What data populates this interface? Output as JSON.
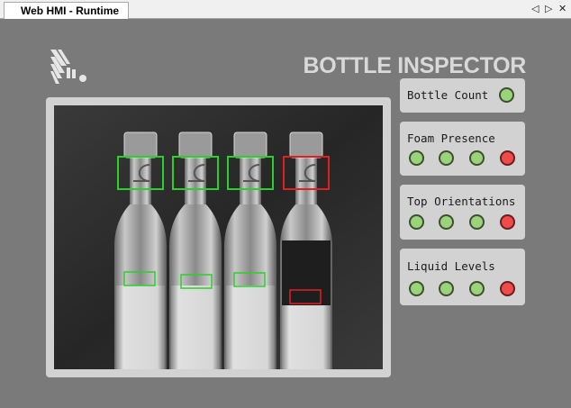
{
  "tab": {
    "title": "Web HMI - Runtime"
  },
  "tab_controls": {
    "prev": "◁",
    "next": "▷",
    "close": "✕"
  },
  "header": {
    "title": "BOTTLE INSPECTOR"
  },
  "panels": {
    "bottle_count": {
      "label": "Bottle Count",
      "leds": [
        "green"
      ]
    },
    "foam_presence": {
      "label": "Foam Presence",
      "leds": [
        "green",
        "green",
        "green",
        "red"
      ]
    },
    "top_orientations": {
      "label": "Top Orientations",
      "leds": [
        "green",
        "green",
        "green",
        "red"
      ]
    },
    "liquid_levels": {
      "label": "Liquid Levels",
      "leds": [
        "green",
        "green",
        "green",
        "red"
      ]
    }
  },
  "colors": {
    "pass": "#9ad37a",
    "fail": "#ef4b4b",
    "pass_roi": "#2bd12b",
    "fail_roi": "#e02020"
  },
  "camera": {
    "bottles": [
      {
        "cap_status": "pass",
        "level_status": "pass"
      },
      {
        "cap_status": "pass",
        "level_status": "pass"
      },
      {
        "cap_status": "pass",
        "level_status": "pass"
      },
      {
        "cap_status": "fail",
        "level_status": "fail"
      }
    ]
  }
}
